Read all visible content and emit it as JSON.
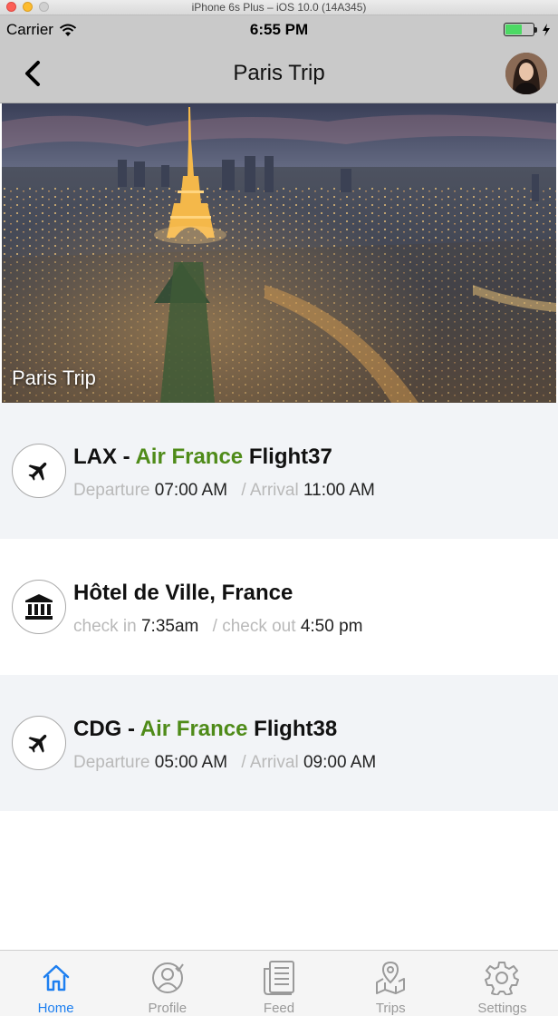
{
  "simulator": {
    "title": "iPhone 6s Plus – iOS 10.0 (14A345)"
  },
  "status_bar": {
    "carrier": "Carrier",
    "time": "6:55 PM",
    "battery_level": 0.6
  },
  "nav": {
    "title": "Paris Trip"
  },
  "hero": {
    "caption": "Paris Trip"
  },
  "timeline": [
    {
      "icon": "airplane-icon",
      "origin": "LAX",
      "dash": " - ",
      "airline": "Air France",
      "flight": "Flight37",
      "label1": "Departure",
      "value1": "07:00 AM",
      "sep": "/",
      "label2": "Arrival",
      "value2": "11:00 AM"
    },
    {
      "icon": "museum-icon",
      "title": "Hôtel de Ville, France",
      "label1": "check in",
      "value1": "7:35am",
      "sep": "/",
      "label2": "check out",
      "value2": "4:50 pm"
    },
    {
      "icon": "airplane-icon",
      "origin": "CDG",
      "dash": " - ",
      "airline": "Air France",
      "flight": "Flight38",
      "label1": "Departure",
      "value1": "05:00 AM",
      "sep": "/",
      "label2": "Arrival",
      "value2": "09:00 AM"
    }
  ],
  "tabs": [
    {
      "label": "Home",
      "icon": "home-icon",
      "active": true
    },
    {
      "label": "Profile",
      "icon": "profile-icon",
      "active": false
    },
    {
      "label": "Feed",
      "icon": "feed-icon",
      "active": false
    },
    {
      "label": "Trips",
      "icon": "map-icon",
      "active": false
    },
    {
      "label": "Settings",
      "icon": "gear-icon",
      "active": false
    }
  ],
  "colors": {
    "accent": "#1d7ff0",
    "airline": "#4f8b19",
    "bar_gray": "#c9c9c9",
    "row_shade": "#f2f4f7"
  }
}
